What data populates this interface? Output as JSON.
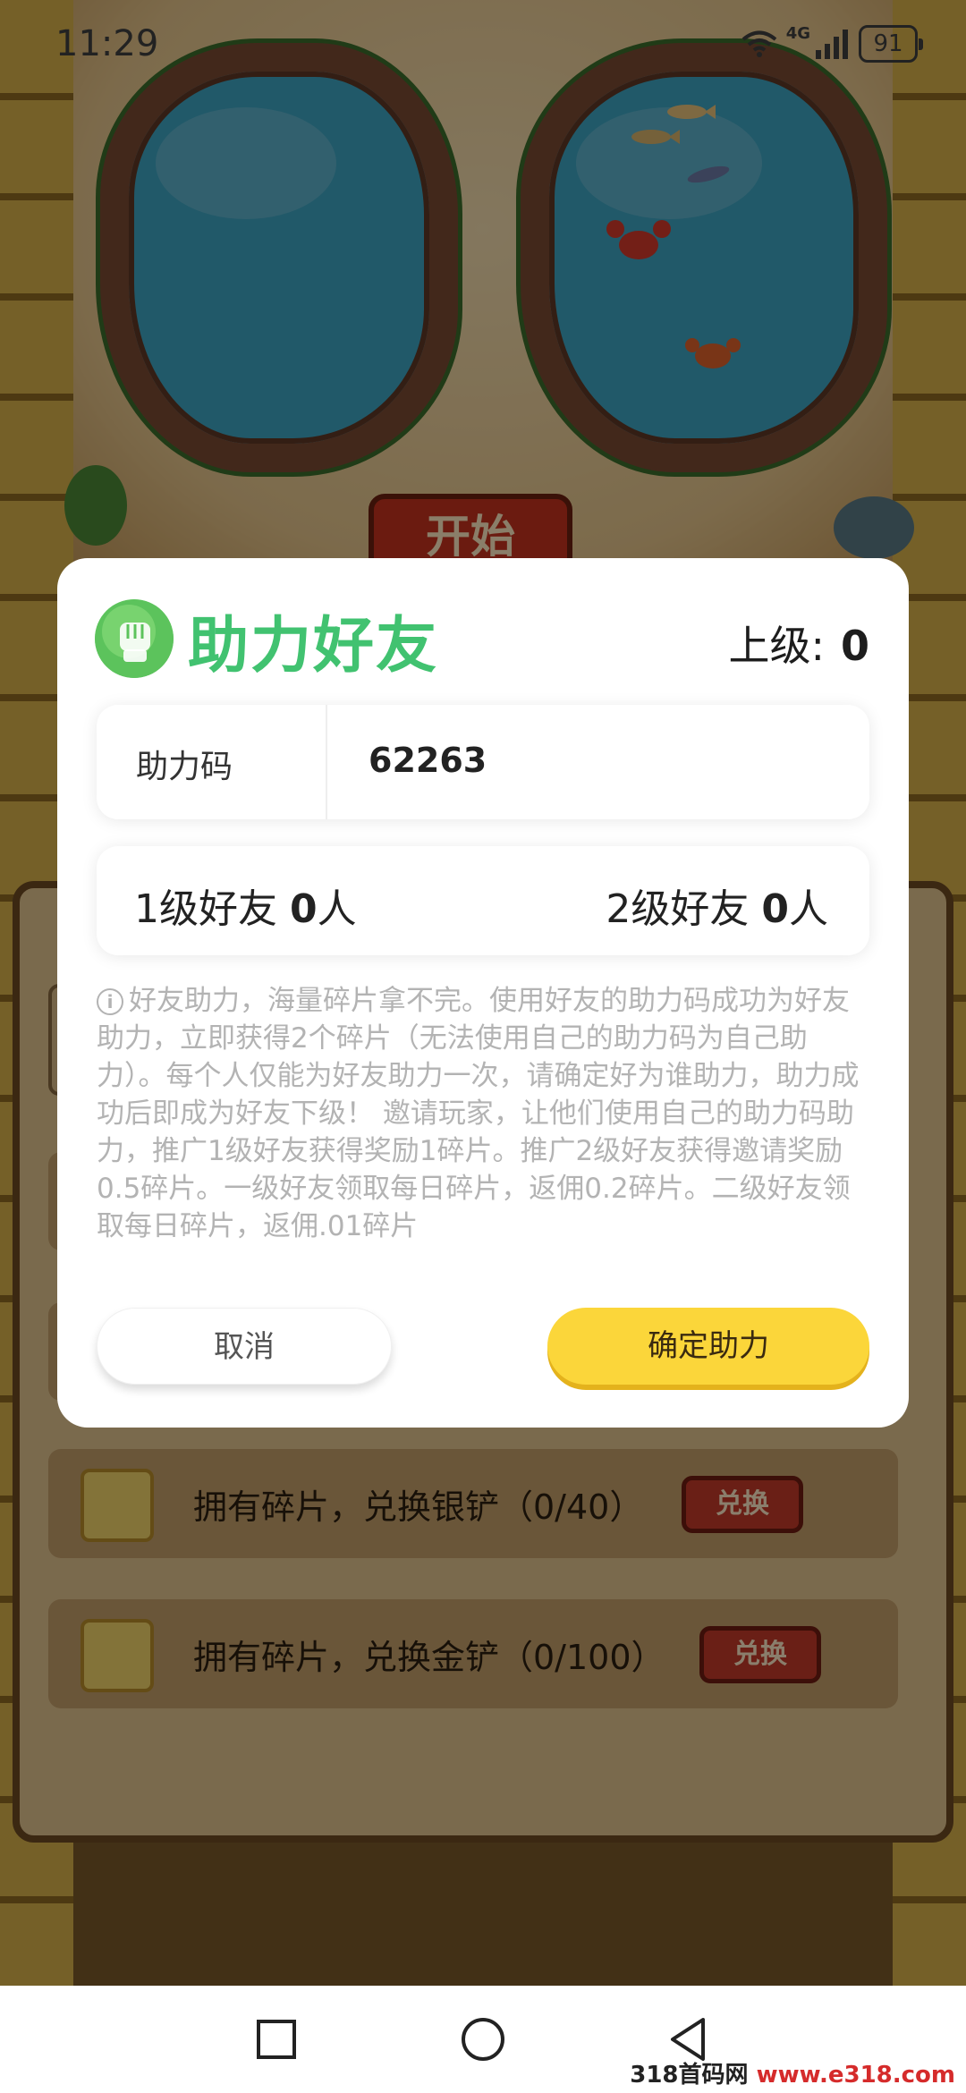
{
  "status_bar": {
    "time": "11:29",
    "network": "4G",
    "battery": "91"
  },
  "game": {
    "start_button": "开始",
    "exchange_rows": [
      {
        "text": "拥有碎片，兑换银铲（0/40）",
        "button": "兑换"
      },
      {
        "text": "拥有碎片，兑换金铲（0/100）",
        "button": "兑换"
      }
    ]
  },
  "dialog": {
    "title": "助力好友",
    "superior_label": "上级:",
    "superior_value": "0",
    "code_label": "助力码",
    "code_value": "62263",
    "level1_label": "1级好友",
    "level1_count": "0",
    "level2_label": "2级好友",
    "level2_count": "0",
    "people_unit": "人",
    "info_text": "好友助力，海量碎片拿不完。使用好友的助力码成功为好友助力，立即获得2个碎片（无法使用自己的助力码为自己助力）。每个人仅能为好友助力一次，请确定好为谁助力，助力成功后即成为好友下级！ 邀请玩家，让他们使用自己的助力码助力，推广1级好友获得奖励1碎片。推广2级好友获得邀请奖励0.5碎片。一级好友领取每日碎片，返佣0.2碎片。二级好友领取每日碎片，返佣.01碎片",
    "cancel_label": "取消",
    "confirm_label": "确定助力"
  },
  "watermark": {
    "site": "318首码网",
    "url": "www.e318.com"
  },
  "icons": {
    "dialog_icon": "fist-icon",
    "nav": [
      "recents-icon",
      "home-icon",
      "back-icon"
    ]
  },
  "colors": {
    "title_green": "#41c270",
    "confirm_yellow": "#fbd63a",
    "info_gray": "#b3b3b3"
  }
}
